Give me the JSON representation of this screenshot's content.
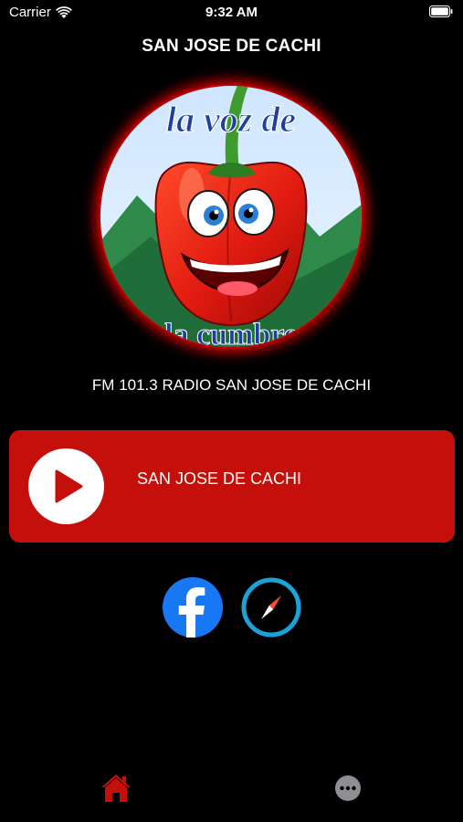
{
  "status_bar": {
    "carrier": "Carrier",
    "time": "9:32 AM"
  },
  "header": {
    "title": "SAN JOSE DE CACHI"
  },
  "logo": {
    "text_top": "la voz de",
    "text_bottom": "la cumbre"
  },
  "station": {
    "subtitle": "FM 101.3 RADIO SAN JOSE DE CACHI"
  },
  "player": {
    "station_name": "SAN JOSE DE CACHI",
    "state": "paused"
  },
  "social": {
    "icons": [
      "facebook-icon",
      "compass-icon"
    ]
  },
  "tab_bar": {
    "tabs": [
      {
        "icon": "home-icon",
        "active": true
      },
      {
        "icon": "more-icon",
        "active": false
      }
    ]
  },
  "colors": {
    "background": "#000000",
    "accent_red": "#c40f0a",
    "facebook_blue": "#1877f2",
    "web_cyan": "#1aa3d8",
    "tab_inactive": "#8e8e93"
  }
}
